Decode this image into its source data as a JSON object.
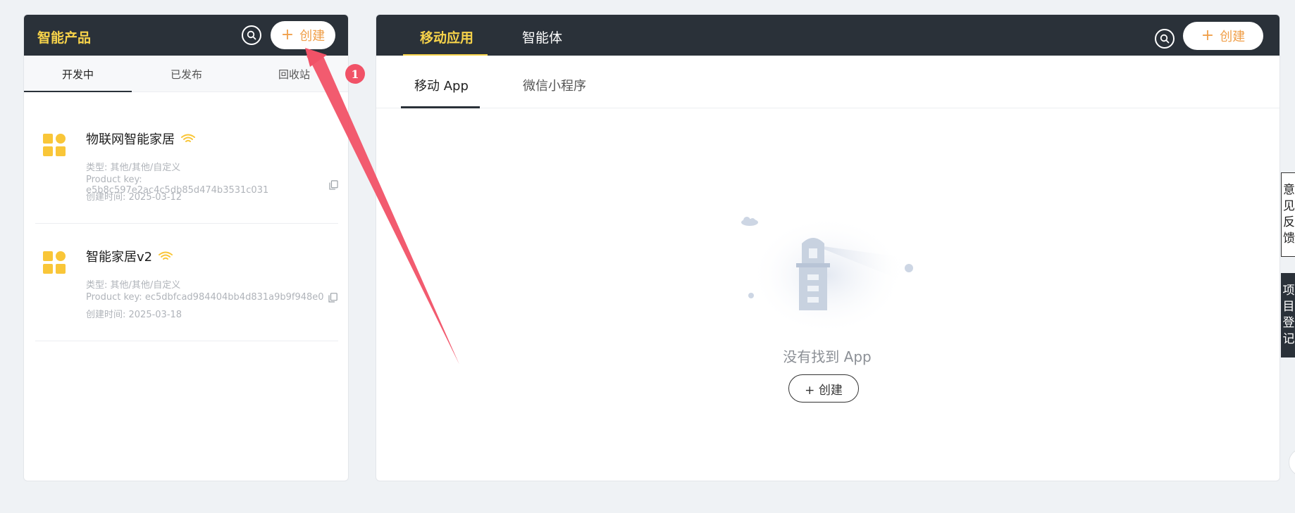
{
  "left_panel": {
    "title": "智能产品",
    "create_label": "创建",
    "tabs": [
      "开发中",
      "已发布",
      "回收站"
    ],
    "products": [
      {
        "name": "物联网智能家居",
        "type": "类型: 其他/其他/自定义",
        "product_key": "Product key: e5b8c597e2ac4c5db85d474b3531c031",
        "created": "创建时间: 2025-03-12"
      },
      {
        "name": "智能家居v2",
        "type": "类型: 其他/其他/自定义",
        "product_key": "Product key: ec5dbfcad984404bb4d831a9b9f948e0",
        "created": "创建时间: 2025-03-18"
      }
    ]
  },
  "right_panel": {
    "header_tabs": [
      "移动应用",
      "智能体"
    ],
    "create_label": "创建",
    "sub_tabs": [
      "移动 App",
      "微信小程序"
    ],
    "empty_text": "没有找到 App",
    "empty_create_label": "+ 创建"
  },
  "side": {
    "feedback": "意见反馈",
    "register": "项目登记"
  },
  "annotation": {
    "badge": "1"
  },
  "colors": {
    "header_bg": "#2a3139",
    "accent_yellow": "#f7d34a",
    "create_orange": "#f0a04b",
    "annotation_red": "#f15267"
  }
}
